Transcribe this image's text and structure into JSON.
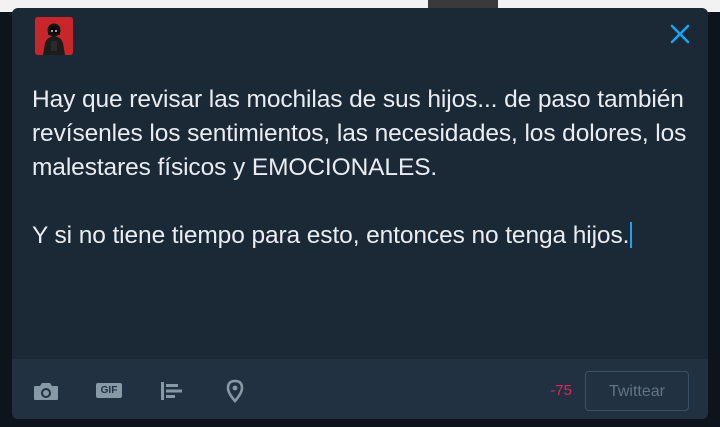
{
  "tweet": {
    "paragraph1": "Hay que revisar las mochilas de sus hijos... de paso también revísenles los sentimientos, las necesidades, los dolores, los malestares físicos y EMOCIONALES.",
    "paragraph2": "Y si no tiene tiempo para esto, entonces no tenga hijos."
  },
  "toolbar": {
    "gif_label": "GIF",
    "char_counter": "-75",
    "tweet_button": "Twittear"
  },
  "icons": {
    "close": "close-icon",
    "camera": "camera-icon",
    "gif": "gif-icon",
    "poll": "poll-icon",
    "location": "location-pin-icon",
    "avatar": "avatar"
  },
  "colors": {
    "dialog_background": "#1b2836",
    "toolbar_background": "#223141",
    "accent": "#1da1f2",
    "counter_negative": "#e0245e",
    "icon_grey": "#8899a6"
  }
}
